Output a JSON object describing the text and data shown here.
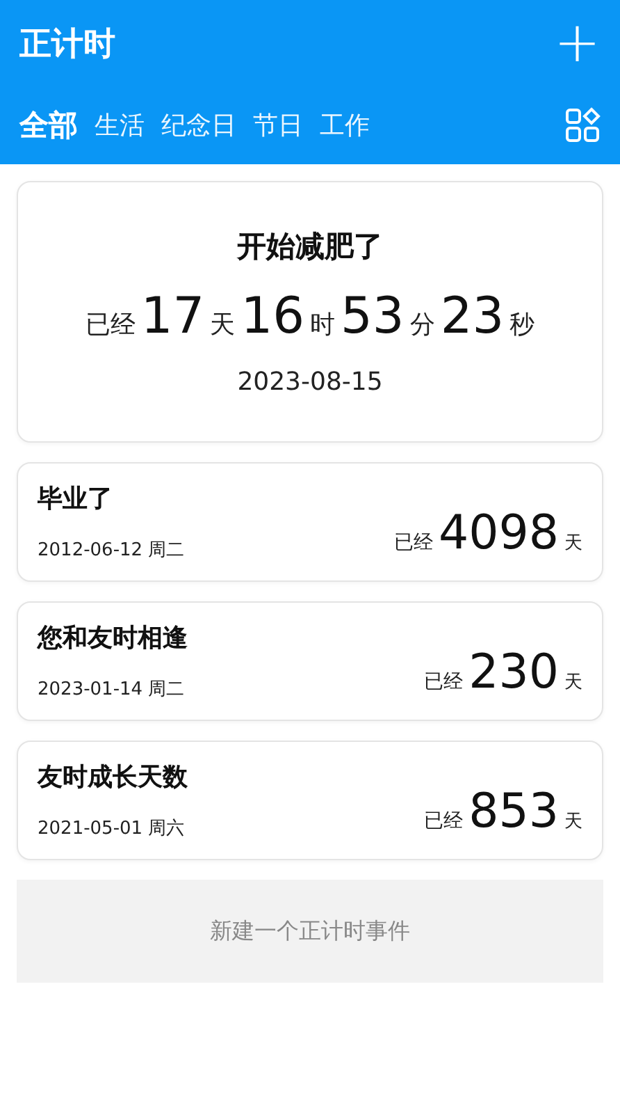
{
  "app_bar": {
    "title": "正计时",
    "add_icon": "+"
  },
  "tabs": [
    {
      "label": "全部",
      "selected": true
    },
    {
      "label": "生活",
      "selected": false
    },
    {
      "label": "纪念日",
      "selected": false
    },
    {
      "label": "节日",
      "selected": false
    },
    {
      "label": "工作",
      "selected": false
    }
  ],
  "featured": {
    "title": "开始减肥了",
    "prefix": "已经",
    "parts": [
      {
        "value": "17",
        "unit": "天"
      },
      {
        "value": "16",
        "unit": "时"
      },
      {
        "value": "53",
        "unit": "分"
      },
      {
        "value": "23",
        "unit": "秒"
      }
    ],
    "date": "2023-08-15"
  },
  "events": [
    {
      "title": "毕业了",
      "date": "2012-06-12 周二",
      "prefix": "已经",
      "count": "4098",
      "unit": "天"
    },
    {
      "title": "您和友时相逢",
      "date": "2023-01-14 周二",
      "prefix": "已经",
      "count": "230",
      "unit": "天"
    },
    {
      "title": "友时成长天数",
      "date": "2021-05-01 周六",
      "prefix": "已经",
      "count": "853",
      "unit": "天"
    }
  ],
  "new_event_button": "新建一个正计时事件"
}
